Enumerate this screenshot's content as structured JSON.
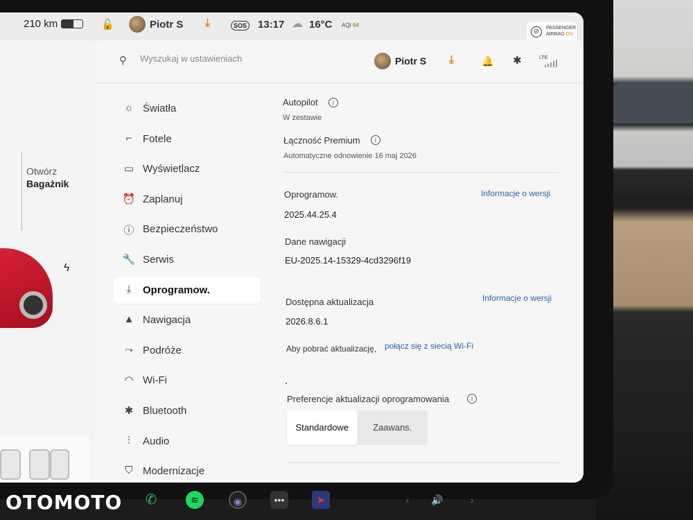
{
  "statusbar": {
    "range": "210 km",
    "battery_level": 0.55,
    "user": "Piotr S",
    "sos": "SOS",
    "time": "13:17",
    "temperature": "16°C",
    "aqi_label": "AQI",
    "aqi_value": "64",
    "airbag_line1": "PASSENGER",
    "airbag_line2": "AIRBAG",
    "airbag_state": "ON"
  },
  "car_panel": {
    "trunk_line1": "Otwórz",
    "trunk_line2": "Bagażnik"
  },
  "search": {
    "placeholder": "Wyszukaj w ustawieniach"
  },
  "topbar": {
    "user": "Piotr S",
    "lte": "LTE"
  },
  "menu": {
    "items": [
      {
        "label": "Światła",
        "icon": "light-icon"
      },
      {
        "label": "Fotele",
        "icon": "seat-icon"
      },
      {
        "label": "Wyświetlacz",
        "icon": "display-icon"
      },
      {
        "label": "Zaplanuj",
        "icon": "alarm-clock-icon"
      },
      {
        "label": "Bezpieczeństwo",
        "icon": "alert-icon"
      },
      {
        "label": "Serwis",
        "icon": "wrench-icon"
      },
      {
        "label": "Oprogramow.",
        "icon": "download-icon",
        "active": true
      },
      {
        "label": "Nawigacja",
        "icon": "navigation-icon"
      },
      {
        "label": "Podróże",
        "icon": "trips-icon"
      },
      {
        "label": "Wi-Fi",
        "icon": "wifi-icon"
      },
      {
        "label": "Bluetooth",
        "icon": "bluetooth-icon"
      },
      {
        "label": "Audio",
        "icon": "audio-icon"
      },
      {
        "label": "Modernizacje",
        "icon": "shopping-bag-icon"
      }
    ]
  },
  "content": {
    "autopilot_title": "Autopilot",
    "autopilot_sub": "W zestawie",
    "premium_title": "Łączność Premium",
    "premium_sub": "Automatyczne odnowienie 16 maj 2026",
    "software_title": "Oprogramow.",
    "software_version": "2025.44.25.4",
    "release_notes_link": "Informacje o wersji",
    "nav_data_title": "Dane nawigacji",
    "nav_data_value": "EU-2025.14-15329-4cd3296f19",
    "update_title": "Dostępna aktualizacja",
    "update_version": "2026.8.6.1",
    "update_notes_link": "Informacje o wersji",
    "download_hint": "Aby pobrać aktualizację,",
    "wifi_link": "połącz się z siecią Wi-Fi",
    "prefs_title": "Preferencje aktualizacji oprogramowania",
    "pref_options": [
      "Standardowe",
      "Zaawans."
    ],
    "pref_selected": "Standardowe"
  },
  "watermark": "OTOMOTO",
  "colors": {
    "link": "#2b5fb4",
    "download_accent": "#e8841a",
    "car_red": "#c4202c"
  }
}
